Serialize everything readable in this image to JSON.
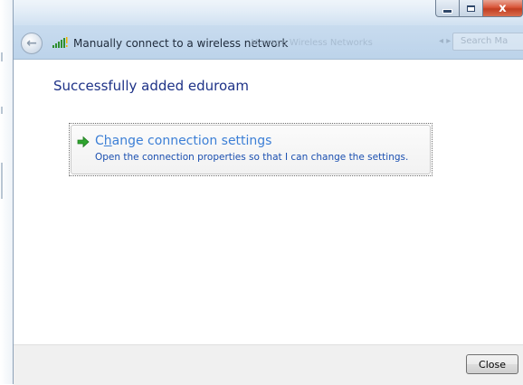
{
  "window": {
    "title": "Manually connect to a wireless network",
    "ghost_address": "Manage Wireless Networks",
    "ghost_search": "Search Ma",
    "caption_close_glyph": "x",
    "back_glyph": "←"
  },
  "content": {
    "heading": "Successfully added eduroam",
    "command_link": {
      "title_prefix": "C",
      "title_underlined": "h",
      "title_rest": "ange connection settings",
      "description": "Open the connection properties so that I can change the settings."
    }
  },
  "footer": {
    "close_label": "Close"
  },
  "colors": {
    "heading": "#1e3287",
    "link_title": "#3c7fd6",
    "link_desc": "#1a4fb0",
    "arrow": "#2fa52f"
  }
}
